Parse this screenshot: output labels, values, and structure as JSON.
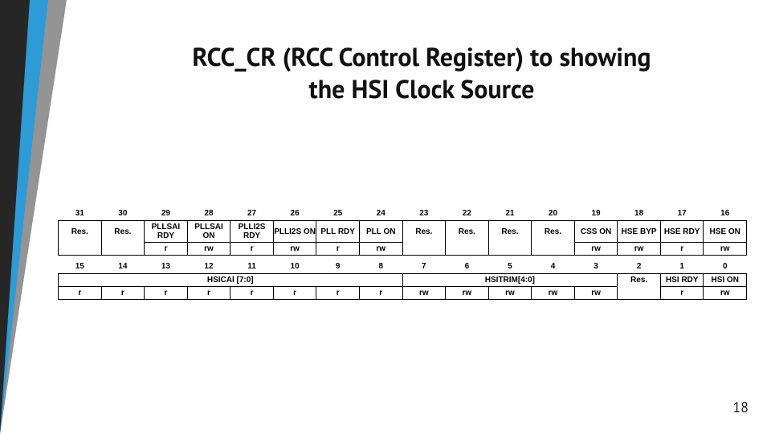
{
  "title_line1": "RCC_CR (RCC Control Register) to showing",
  "title_line2": "the HSI Clock Source",
  "page_number": "18",
  "upper": {
    "bits": [
      "31",
      "30",
      "29",
      "28",
      "27",
      "26",
      "25",
      "24",
      "23",
      "22",
      "21",
      "20",
      "19",
      "18",
      "17",
      "16"
    ],
    "names": [
      "Res.",
      "Res.",
      "PLLSAI RDY",
      "PLLSAI ON",
      "PLLI2S RDY",
      "PLLI2S ON",
      "PLL RDY",
      "PLL ON",
      "Res.",
      "Res.",
      "Res.",
      "Res.",
      "CSS ON",
      "HSE BYP",
      "HSE RDY",
      "HSE ON"
    ],
    "rw": [
      "",
      "",
      "r",
      "rw",
      "r",
      "rw",
      "r",
      "rw",
      "",
      "",
      "",
      "",
      "rw",
      "rw",
      "r",
      "rw"
    ]
  },
  "lower": {
    "bits": [
      "15",
      "14",
      "13",
      "12",
      "11",
      "10",
      "9",
      "8",
      "7",
      "6",
      "5",
      "4",
      "3",
      "2",
      "1",
      "0"
    ],
    "group1": "HSICAl [7:0]",
    "group2": "HSITRIM[4:0]",
    "res": "Res.",
    "n14": "HSI RDY",
    "n15": "HSI ON",
    "rw": [
      "r",
      "r",
      "r",
      "r",
      "r",
      "r",
      "r",
      "r",
      "rw",
      "rw",
      "rw",
      "rw",
      "rw",
      "",
      "r",
      "rw"
    ]
  }
}
